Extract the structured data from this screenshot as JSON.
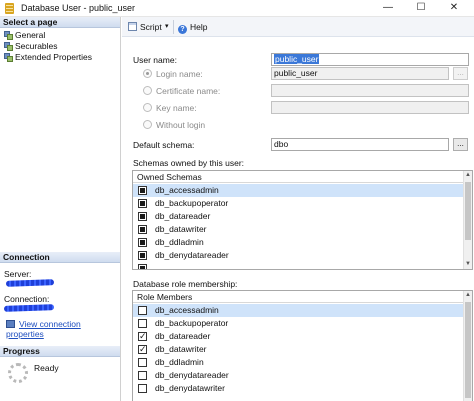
{
  "window": {
    "title": "Database User - public_user",
    "min": "—",
    "max": "☐",
    "close": "✕"
  },
  "left": {
    "select_page_header": "Select a page",
    "pages": [
      {
        "label": "General"
      },
      {
        "label": "Securables"
      },
      {
        "label": "Extended Properties"
      }
    ],
    "connection_header": "Connection",
    "server_label": "Server:",
    "connection_label": "Connection:",
    "view_connection_link": "View connection properties",
    "progress_header": "Progress",
    "progress_status": "Ready"
  },
  "toolbar": {
    "script_label": "Script",
    "help_label": "Help",
    "caret": "▾",
    "help_glyph": "?"
  },
  "form": {
    "user_name_label": "User name:",
    "user_name_value": "public_user",
    "login_name_label": "Login name:",
    "login_name_value": "public_user",
    "certificate_name_label": "Certificate name:",
    "key_name_label": "Key name:",
    "without_login_label": "Without login",
    "default_schema_label": "Default schema:",
    "default_schema_value": "dbo",
    "ellipsis": "...",
    "schemas_owned_label": "Schemas owned by this user:",
    "role_membership_label": "Database role membership:"
  },
  "schemas": {
    "header": "Owned Schemas",
    "rows": [
      {
        "name": "db_accessadmin",
        "state": "filled",
        "selected": true
      },
      {
        "name": "db_backupoperator",
        "state": "filled"
      },
      {
        "name": "db_datareader",
        "state": "filled"
      },
      {
        "name": "db_datawriter",
        "state": "filled"
      },
      {
        "name": "db_ddladmin",
        "state": "filled"
      },
      {
        "name": "db_denydatareader",
        "state": "filled"
      }
    ]
  },
  "roles": {
    "header": "Role Members",
    "rows": [
      {
        "name": "db_accessadmin",
        "state": "unchecked",
        "selected": true
      },
      {
        "name": "db_backupoperator",
        "state": "unchecked"
      },
      {
        "name": "db_datareader",
        "state": "checked"
      },
      {
        "name": "db_datawriter",
        "state": "checked"
      },
      {
        "name": "db_ddladmin",
        "state": "unchecked"
      },
      {
        "name": "db_denydatareader",
        "state": "unchecked"
      },
      {
        "name": "db_denydatawriter",
        "state": "unchecked"
      }
    ]
  },
  "colors": {
    "header_blue": "#cfdcef",
    "link_blue": "#1f4fbf",
    "selection": "#3b78d8",
    "row_highlight": "#cfe3fa"
  }
}
